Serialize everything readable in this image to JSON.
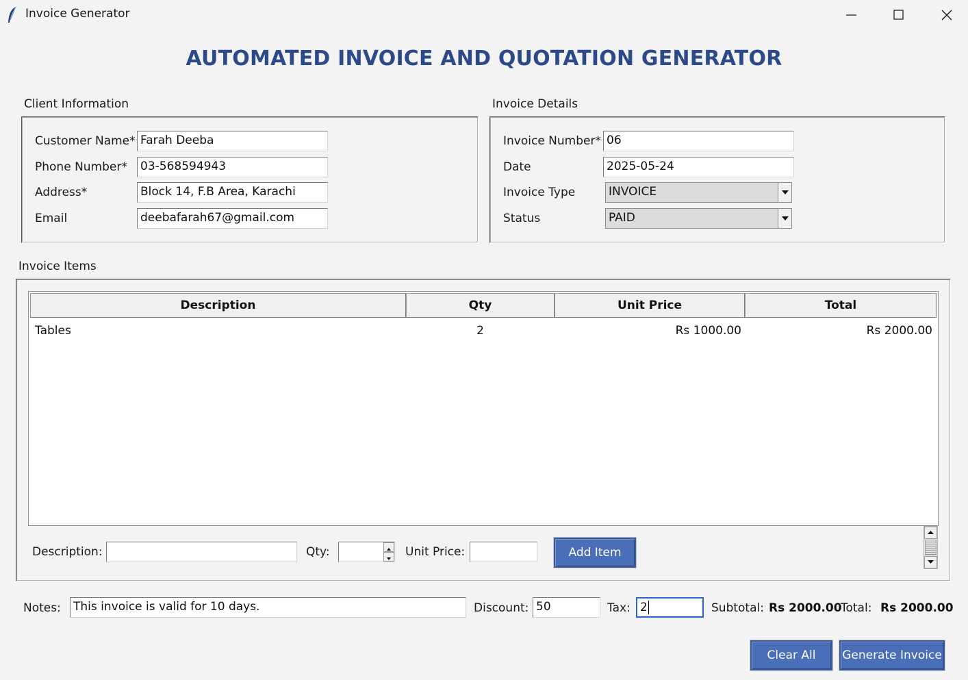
{
  "window": {
    "title": "Invoice Generator",
    "minimize_icon": "minimize-icon",
    "maximize_icon": "maximize-icon",
    "close_icon": "close-icon",
    "app_icon": "feather-icon"
  },
  "heading": "AUTOMATED INVOICE AND QUOTATION GENERATOR",
  "client": {
    "section_label": "Client Information",
    "fields": [
      {
        "label": "Customer Name*",
        "value": "Farah Deeba"
      },
      {
        "label": "Phone Number*",
        "value": "03-568594943"
      },
      {
        "label": "Address*",
        "value": "Block 14, F.B Area, Karachi"
      },
      {
        "label": "Email",
        "value": "deebafarah67@gmail.com"
      }
    ]
  },
  "details": {
    "section_label": "Invoice Details",
    "invoice_number_label": "Invoice Number*",
    "invoice_number": "06",
    "date_label": "Date",
    "date": "2025-05-24",
    "type_label": "Invoice Type",
    "type": "INVOICE",
    "status_label": "Status",
    "status": "PAID"
  },
  "items": {
    "section_label": "Invoice Items",
    "columns": [
      "Description",
      "Qty",
      "Unit Price",
      "Total"
    ],
    "rows": [
      {
        "description": "Tables",
        "qty": "2",
        "unit_price": "Rs 1000.00",
        "total": "Rs 2000.00"
      }
    ],
    "description_label": "Description:",
    "description_value": "",
    "qty_label": "Qty:",
    "qty_value": "",
    "unit_price_label": "Unit Price:",
    "unit_price_value": "",
    "add_button": "Add Item"
  },
  "footer": {
    "notes_label": "Notes:",
    "notes_value": "This invoice is valid for 10 days.",
    "discount_label": "Discount:",
    "discount_value": "50",
    "tax_label": "Tax:",
    "tax_value": "2",
    "subtotal_label": "Subtotal:",
    "subtotal_value": "Rs 2000.00",
    "total_label": "Total:",
    "total_value": "Rs 2000.00",
    "clear_button": "Clear All",
    "generate_button": "Generate Invoice"
  },
  "colors": {
    "heading": "#2c4a8a",
    "button_bg": "#4a6fb8",
    "focus_border": "#2a66c6"
  }
}
